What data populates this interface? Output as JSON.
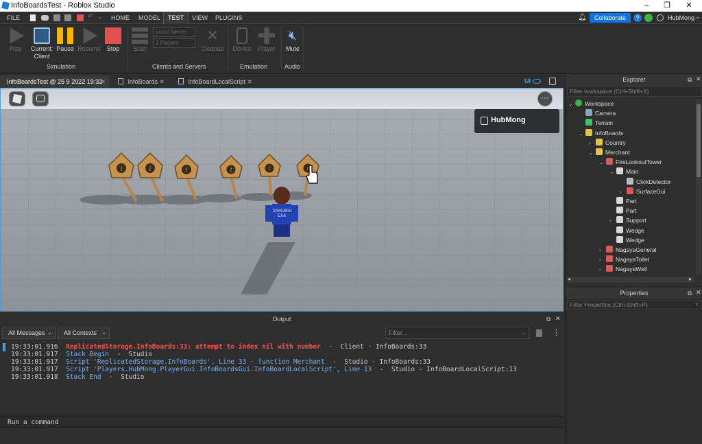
{
  "window": {
    "title": "InfoBoardsTest - Roblox Studio",
    "controls": [
      "–",
      "❐",
      "✕"
    ]
  },
  "menubar": {
    "file": "FILE",
    "tabs": [
      "HOME",
      "MODEL",
      "TEST",
      "VIEW",
      "PLUGINS"
    ],
    "active_tab": "TEST",
    "collaborate": "Collaborate",
    "user": "HubMong"
  },
  "ribbon": {
    "buttons": {
      "play": "Play",
      "current_client": "Current:\nClient",
      "pause": "Pause",
      "resume": "Resume",
      "stop": "Stop",
      "start": "Start",
      "cleanup": "Cleanup",
      "device": "Device",
      "player": "Player",
      "mute": "Mute"
    },
    "dropdowns": {
      "server": "Local Server",
      "players": "2 Players"
    },
    "groups": {
      "simulation": "Simulation",
      "clients_servers": "Clients and Servers",
      "emulation": "Emulation",
      "audio": "Audio"
    },
    "colors": {
      "pause": "#f5b700",
      "stop": "#e05252",
      "accent": "#0b74e5"
    }
  },
  "doc_tabs": [
    {
      "label": "InfoBoardsTest @ 25 9 2022 19:32",
      "active": true
    },
    {
      "label": "InfoBoards",
      "active": false
    },
    {
      "label": "InfoBoardLocalScript",
      "active": false
    }
  ],
  "viewport": {
    "ui_toggle": "UI",
    "player_badge": "HubMong",
    "shirt_text": "SAMURAI\nEXA",
    "sign_count": 6
  },
  "output": {
    "title": "Output",
    "filters": {
      "messages": "All Messages",
      "contexts": "All Contexts",
      "filter_placeholder": "Filter..."
    },
    "lines": [
      {
        "time": "19:33:01.916",
        "text": "ReplicatedStorage.InfoBoards:33: attempt to index nil with number",
        "source": "  -  Client - InfoBoards:33",
        "kind": "error"
      },
      {
        "time": "19:33:01.917",
        "text": "Stack Begin",
        "source": "  -  Studio",
        "kind": "info"
      },
      {
        "time": "19:33:01.917",
        "text": "Script 'ReplicatedStorage.InfoBoards', Line 33 - function Merchant",
        "source": "  -  Studio - InfoBoards:33",
        "kind": "info"
      },
      {
        "time": "19:33:01.917",
        "text": "Script 'Players.HubMong.PlayerGui.InfoBoardsGui.InfoBoardLocalScript', Line 13",
        "source": "  -  Studio - InfoBoardLocalScript:13",
        "kind": "info"
      },
      {
        "time": "19:33:01.918",
        "text": "Stack End",
        "source": "  -  Studio",
        "kind": "info"
      }
    ],
    "command_placeholder": "Run a command"
  },
  "explorer": {
    "title": "Explorer",
    "filter_placeholder": "Filter workspace (Ctrl+Shift+X)",
    "items": [
      {
        "label": "Workspace",
        "depth": 0,
        "arrow": "⌄",
        "icon": "globe-icon",
        "color": "#3ab54a"
      },
      {
        "label": "Camera",
        "depth": 1,
        "arrow": "",
        "icon": "camera-icon",
        "color": "#8aa4c8"
      },
      {
        "label": "Terrain",
        "depth": 1,
        "arrow": "",
        "icon": "terrain-icon",
        "color": "#3fbf6a"
      },
      {
        "label": "InfoBoards",
        "depth": 1,
        "arrow": "⌄",
        "icon": "folder-icon",
        "color": "#e7c24a"
      },
      {
        "label": "Country",
        "depth": 2,
        "arrow": "›",
        "icon": "folder-icon",
        "color": "#e7c24a"
      },
      {
        "label": "Merchant",
        "depth": 2,
        "arrow": "⌄",
        "icon": "folder-icon",
        "color": "#e7c24a"
      },
      {
        "label": "FireLookoutTower",
        "depth": 3,
        "arrow": "⌄",
        "icon": "model-icon",
        "color": "#d95a5a"
      },
      {
        "label": "Main",
        "depth": 4,
        "arrow": "⌄",
        "icon": "part-icon",
        "color": "#d8d8d8"
      },
      {
        "label": "ClickDetector",
        "depth": 5,
        "arrow": "",
        "icon": "click-detector-icon",
        "color": "#bbbbbb"
      },
      {
        "label": "SurfaceGui",
        "depth": 5,
        "arrow": "›",
        "icon": "surfacegui-icon",
        "color": "#d95a5a"
      },
      {
        "label": "Part",
        "depth": 4,
        "arrow": "",
        "icon": "part-icon",
        "color": "#d8d8d8"
      },
      {
        "label": "Part",
        "depth": 4,
        "arrow": "",
        "icon": "part-icon",
        "color": "#d8d8d8"
      },
      {
        "label": "Support",
        "depth": 4,
        "arrow": "›",
        "icon": "part-icon",
        "color": "#d8d8d8"
      },
      {
        "label": "Wedge",
        "depth": 4,
        "arrow": "",
        "icon": "part-icon",
        "color": "#d8d8d8"
      },
      {
        "label": "Wedge",
        "depth": 4,
        "arrow": "",
        "icon": "part-icon",
        "color": "#d8d8d8"
      },
      {
        "label": "NagayaGeneral",
        "depth": 3,
        "arrow": "›",
        "icon": "model-icon",
        "color": "#d95a5a"
      },
      {
        "label": "NagayaToilet",
        "depth": 3,
        "arrow": "›",
        "icon": "model-icon",
        "color": "#d95a5a"
      },
      {
        "label": "NagayaWell",
        "depth": 3,
        "arrow": "›",
        "icon": "model-icon",
        "color": "#d95a5a"
      }
    ]
  },
  "properties": {
    "title": "Properties",
    "filter_placeholder": "Filter Properties (Ctrl+Shift+P)"
  }
}
